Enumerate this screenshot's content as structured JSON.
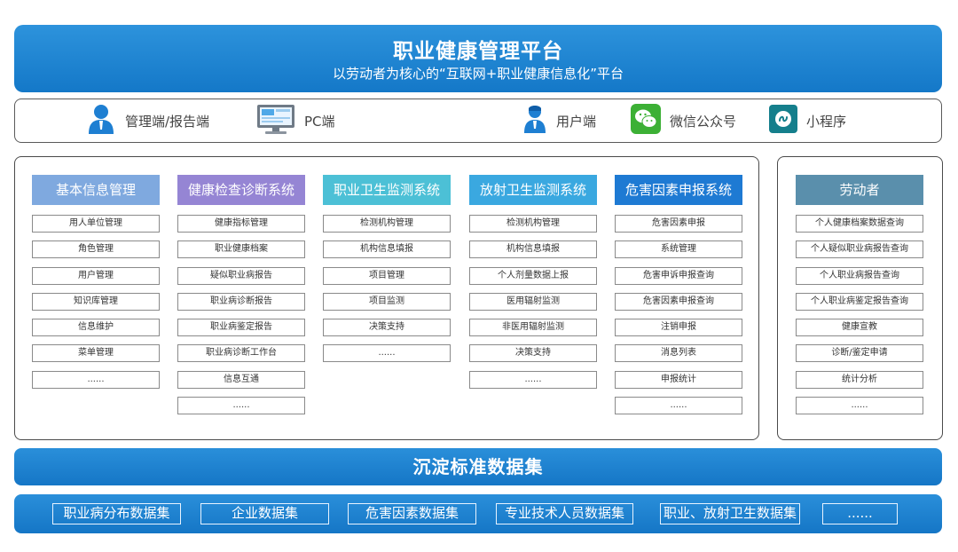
{
  "header": {
    "title": "职业健康管理平台",
    "subtitle": "以劳动者为核心的“互联网+职业健康信息化”平台"
  },
  "clients": [
    {
      "label": "管理端/报告端",
      "icon": "admin-user-icon"
    },
    {
      "label": "PC端",
      "icon": "monitor-icon"
    },
    {
      "label": "用户端",
      "icon": "user-icon"
    },
    {
      "label": "微信公众号",
      "icon": "wechat-icon"
    },
    {
      "label": "小程序",
      "icon": "mini-program-icon"
    }
  ],
  "systems": [
    {
      "title": "基本信息管理",
      "color": "#7fa9df",
      "items": [
        "用人单位管理",
        "角色管理",
        "用户管理",
        "知识库管理",
        "信息维护",
        "菜单管理",
        "......"
      ]
    },
    {
      "title": "健康检查诊断系统",
      "color": "#9585d4",
      "items": [
        "健康指标管理",
        "职业健康档案",
        "疑似职业病报告",
        "职业病诊断报告",
        "职业病鉴定报告",
        "职业病诊断工作台",
        "信息互通",
        "......"
      ]
    },
    {
      "title": "职业卫生监测系统",
      "color": "#4cc0d6",
      "items": [
        "检测机构管理",
        "机构信息填报",
        "项目管理",
        "项目监测",
        "决策支持",
        "......"
      ]
    },
    {
      "title": "放射卫生监测系统",
      "color": "#3aa8e0",
      "items": [
        "检测机构管理",
        "机构信息填报",
        "个人剂量数据上报",
        "医用辐射监测",
        "非医用辐射监测",
        "决策支持",
        "......"
      ]
    },
    {
      "title": "危害因素申报系统",
      "color": "#1e7ad3",
      "items": [
        "危害因素申报",
        "系统管理",
        "危害申诉申报查询",
        "危害因素申报查询",
        "注销申报",
        "消息列表",
        "申报统计",
        "......"
      ]
    }
  ],
  "worker": {
    "title": "劳动者",
    "color": "#5a8fac",
    "items": [
      "个人健康档案数据查询",
      "个人疑似职业病报告查询",
      "个人职业病报告查询",
      "个人职业病鉴定报告查询",
      "健康宣教",
      "诊断/鉴定申请",
      "统计分析",
      "......"
    ]
  },
  "dataset_title": "沉淀标准数据集",
  "datasets": [
    "职业病分布数据集",
    "企业数据集",
    "危害因素数据集",
    "专业技术人员数据集",
    "职业、放射卫生数据集",
    "......"
  ]
}
